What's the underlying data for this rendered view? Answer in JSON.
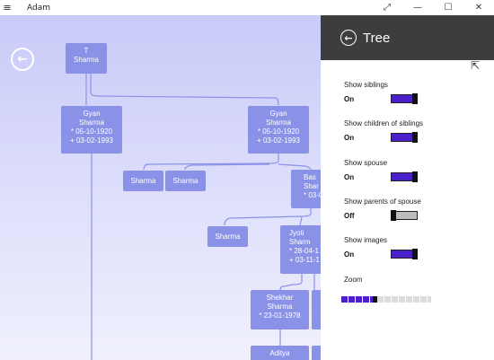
{
  "window": {
    "title": "Adam",
    "menu_icon": "hamburger-icon",
    "controls": [
      "expand-icon",
      "minimize-icon",
      "maximize-icon",
      "close-icon"
    ]
  },
  "tree": {
    "nodes": [
      {
        "id": "t-sharma",
        "lines": [
          "T",
          "Sharma"
        ]
      },
      {
        "id": "gyan-1",
        "lines": [
          "Gyan",
          "Sharma",
          "* 05-10-1920",
          "+ 03-02-1993"
        ]
      },
      {
        "id": "gyan-2",
        "lines": [
          "Gyan",
          "Sharma",
          "* 05-10-1920",
          "+ 03-02-1993"
        ]
      },
      {
        "id": "sharma-a",
        "lines": [
          "Sharma"
        ]
      },
      {
        "id": "sharma-b",
        "lines": [
          "Sharma"
        ]
      },
      {
        "id": "bas",
        "lines": [
          "Bas",
          "Shar",
          "* 03-0"
        ]
      },
      {
        "id": "sharma-c",
        "lines": [
          "Sharma"
        ]
      },
      {
        "id": "jyoti",
        "lines": [
          "Jyoti",
          "Sharm",
          "* 28-04-1",
          "+ 03-11-1"
        ]
      },
      {
        "id": "shekhar",
        "lines": [
          "Shekhar",
          "Sharma",
          "* 23-01-1978"
        ]
      },
      {
        "id": "aditya",
        "lines": [
          "Aditya"
        ]
      }
    ]
  },
  "panel": {
    "title": "Tree",
    "settings": [
      {
        "label": "Show siblings",
        "state": "On"
      },
      {
        "label": "Show children of siblings",
        "state": "On"
      },
      {
        "label": "Show spouse",
        "state": "On"
      },
      {
        "label": "Show parents of spouse",
        "state": "Off"
      },
      {
        "label": "Show images",
        "state": "On"
      }
    ],
    "zoom_label": "Zoom",
    "zoom_level": 0.35
  },
  "colors": {
    "accent": "#4b20c8",
    "node": "#8a92e8",
    "panel_header": "#3d3d3d"
  }
}
